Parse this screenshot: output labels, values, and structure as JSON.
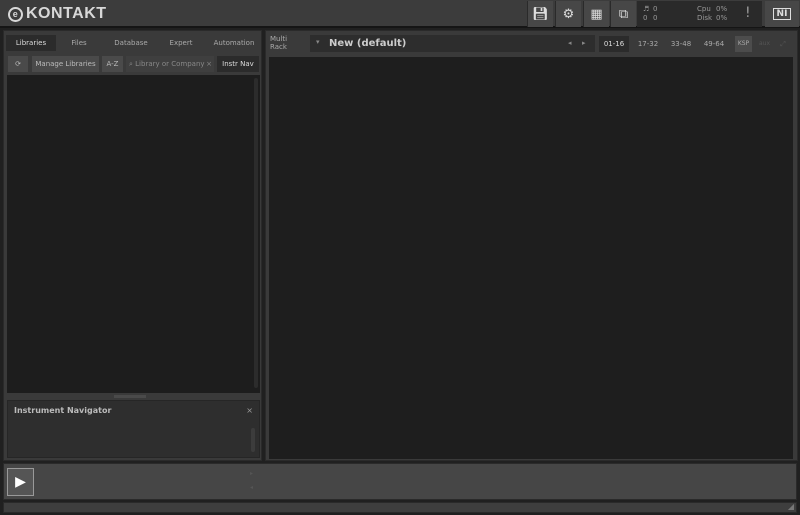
{
  "app": {
    "title": "KONTAKT"
  },
  "toolbar": {
    "save": "save-icon",
    "settings": "gear-icon",
    "view": "layout-icon",
    "resize": "resize-icon"
  },
  "meters": {
    "midi": "0",
    "voices": "0",
    "mem1": "0",
    "mem2": "0",
    "cpu_label": "Cpu",
    "cpu": "0%",
    "disk_label": "Disk",
    "disk": "0%",
    "warning": "!"
  },
  "ni_logo": "NI",
  "browser": {
    "tabs": [
      "Libraries",
      "Files",
      "Database",
      "Expert",
      "Automation"
    ],
    "manage": "Manage Libraries",
    "az": "A-Z",
    "search_placeholder": "Library or Company",
    "instr_nav": "Instr Nav"
  },
  "navigator": {
    "title": "Instrument Navigator",
    "close": "×"
  },
  "rack": {
    "label_line1": "Multi",
    "label_line2": "Rack",
    "name": "New (default)",
    "pages": [
      "01-16",
      "17-32",
      "33-48",
      "49-64"
    ],
    "ksp": "KSP",
    "aux": "aux"
  }
}
